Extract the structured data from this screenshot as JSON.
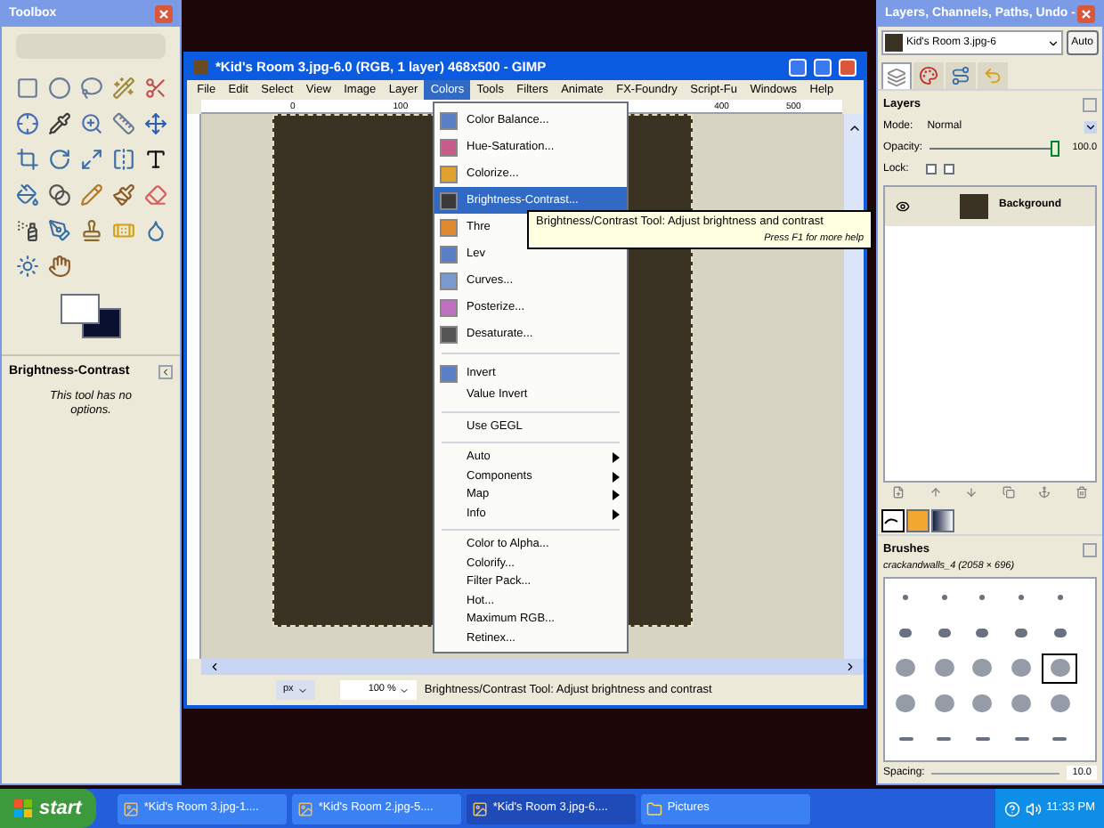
{
  "toolbox": {
    "title": "Toolbox",
    "options_title": "Brightness-Contrast",
    "options_text": "This tool has no options."
  },
  "image_window": {
    "title": "*Kid's Room 3.jpg-6.0 (RGB, 1 layer) 468x500 - GIMP",
    "menus": [
      {
        "label": "File",
        "selected": false
      },
      {
        "label": "Edit",
        "selected": false
      },
      {
        "label": "Select",
        "selected": false
      },
      {
        "label": "View",
        "selected": false
      },
      {
        "label": "Image",
        "selected": false
      },
      {
        "label": "Layer",
        "selected": false
      },
      {
        "label": "Colors",
        "selected": true
      },
      {
        "label": "Tools",
        "selected": false
      },
      {
        "label": "Filters",
        "selected": false
      },
      {
        "label": "Animate",
        "selected": false
      },
      {
        "label": "FX-Foundry",
        "selected": false
      },
      {
        "label": "Script-Fu",
        "selected": false
      },
      {
        "label": "Windows",
        "selected": false
      },
      {
        "label": "Help",
        "selected": false
      }
    ],
    "ruler_labels": [
      "0",
      "100",
      "400",
      "500"
    ],
    "unit": "px",
    "zoom": "100 %",
    "status": "Brightness/Contrast Tool: Adjust brightness and contrast"
  },
  "colors_menu": [
    {
      "kind": "tool",
      "label": "Color Balance...",
      "selected": false
    },
    {
      "kind": "tool",
      "label": "Hue-Saturation...",
      "selected": false
    },
    {
      "kind": "tool",
      "label": "Colorize...",
      "selected": false
    },
    {
      "kind": "tool",
      "label": "Brightness-Contrast...",
      "selected": true
    },
    {
      "kind": "tool",
      "label": "Thre",
      "selected": false
    },
    {
      "kind": "tool",
      "label": "Lev",
      "selected": false
    },
    {
      "kind": "tool",
      "label": "Curves...",
      "selected": false
    },
    {
      "kind": "tool",
      "label": "Posterize...",
      "selected": false
    },
    {
      "kind": "tool",
      "label": "Desaturate...",
      "selected": false
    },
    {
      "kind": "separator"
    },
    {
      "kind": "tool",
      "label": "Invert",
      "selected": false
    },
    {
      "kind": "item",
      "label": "Value Invert",
      "selected": false
    },
    {
      "kind": "separator"
    },
    {
      "kind": "item",
      "label": "Use GEGL",
      "selected": false
    },
    {
      "kind": "separator"
    },
    {
      "kind": "submenu",
      "label": "Auto",
      "selected": false
    },
    {
      "kind": "submenu",
      "label": "Components",
      "selected": false
    },
    {
      "kind": "submenu",
      "label": "Map",
      "selected": false
    },
    {
      "kind": "submenu",
      "label": "Info",
      "selected": false
    },
    {
      "kind": "separator"
    },
    {
      "kind": "item",
      "label": "Color to Alpha...",
      "selected": false
    },
    {
      "kind": "item",
      "label": "Colorify...",
      "selected": false
    },
    {
      "kind": "item",
      "label": "Filter Pack...",
      "selected": false
    },
    {
      "kind": "item",
      "label": "Hot...",
      "selected": false
    },
    {
      "kind": "item",
      "label": "Maximum RGB...",
      "selected": false
    },
    {
      "kind": "item",
      "label": "Retinex...",
      "selected": false
    }
  ],
  "tooltip": {
    "text": "Brightness/Contrast Tool: Adjust brightness and contrast",
    "hint": "Press F1 for more help"
  },
  "dock": {
    "title": "Layers, Channels, Paths, Undo -",
    "image": "Kid's Room 3.jpg-6",
    "auto": "Auto",
    "tabs": [
      {
        "selected": true
      },
      {
        "selected": false
      },
      {
        "selected": false
      },
      {
        "selected": false
      }
    ],
    "layers_title": "Layers",
    "mode_label": "Mode:",
    "mode": "Normal",
    "opacity_label": "Opacity:",
    "opacity": {
      "level": 1.0,
      "reading": "100.0"
    },
    "lock_label": "Lock:",
    "lock": [
      {
        "checked": false
      },
      {
        "checked": false
      }
    ],
    "layers": [
      {
        "name": "Background",
        "visible": true,
        "selected": true
      }
    ],
    "brush_tabs": [
      {
        "selected": true
      },
      {
        "selected": false
      },
      {
        "selected": false
      }
    ],
    "brushes_title": "Brushes",
    "brush_name": "crackandwalls_4 (2058 × 696)",
    "brushes": [
      {
        "selected": false
      },
      {
        "selected": false
      },
      {
        "selected": false
      },
      {
        "selected": false
      },
      {
        "selected": false
      },
      {
        "selected": false
      },
      {
        "selected": false
      },
      {
        "selected": false
      },
      {
        "selected": false
      },
      {
        "selected": false
      },
      {
        "selected": false
      },
      {
        "selected": false
      },
      {
        "selected": false
      },
      {
        "selected": false
      },
      {
        "selected": true
      },
      {
        "selected": false
      },
      {
        "selected": false
      },
      {
        "selected": false
      },
      {
        "selected": false
      },
      {
        "selected": false
      },
      {
        "selected": false
      },
      {
        "selected": false
      },
      {
        "selected": false
      },
      {
        "selected": false
      },
      {
        "selected": false
      }
    ],
    "spacing_label": "Spacing:",
    "spacing": "10.0"
  },
  "taskbar": {
    "start": "start",
    "tasks": [
      {
        "label": "*Kid's Room 3.jpg-1....",
        "selected": false
      },
      {
        "label": "*Kid's Room 2.jpg-5....",
        "selected": false
      },
      {
        "label": "*Kid's Room 3.jpg-6....",
        "selected": true
      },
      {
        "label": "Pictures",
        "selected": false
      }
    ],
    "clock": "11:33 PM"
  }
}
